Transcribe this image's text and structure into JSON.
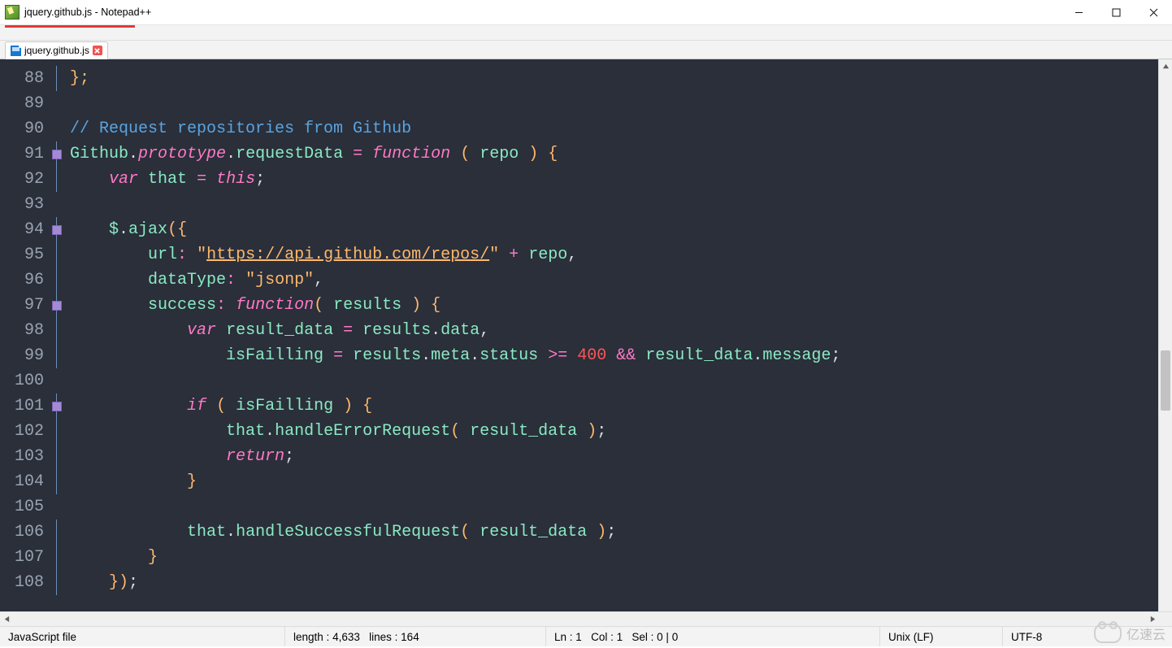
{
  "window": {
    "title": "jquery.github.js - Notepad++"
  },
  "tabs": [
    {
      "label": "jquery.github.js",
      "modified": false,
      "active": true
    }
  ],
  "editor": {
    "first_line_no": 88,
    "fold": [
      "line",
      "",
      "",
      "sq-line",
      "line",
      "",
      "sq-line",
      "line",
      "line",
      "sq-line",
      "line",
      "line",
      "",
      "sq-line",
      "line",
      "line",
      "line",
      "",
      "line",
      "line",
      "line"
    ],
    "code_lines": [
      {
        "t": [
          [
            "brace",
            "};"
          ]
        ]
      },
      {
        "t": []
      },
      {
        "t": [
          [
            "comment",
            "// Request repositories from Github"
          ]
        ]
      },
      {
        "t": [
          [
            "ident",
            "Github"
          ],
          [
            "punc",
            "."
          ],
          [
            "kw2",
            "prototype"
          ],
          [
            "punc",
            "."
          ],
          [
            "ident",
            "requestData"
          ],
          [
            "punc",
            " "
          ],
          [
            "op",
            "="
          ],
          [
            "punc",
            " "
          ],
          [
            "kw2",
            "function"
          ],
          [
            "punc",
            " "
          ],
          [
            "brace",
            "("
          ],
          [
            "punc",
            " "
          ],
          [
            "ident",
            "repo"
          ],
          [
            "punc",
            " "
          ],
          [
            "brace",
            ")"
          ],
          [
            "punc",
            " "
          ],
          [
            "brace",
            "{"
          ]
        ]
      },
      {
        "t": [
          [
            "punc",
            "    "
          ],
          [
            "kw2",
            "var"
          ],
          [
            "punc",
            " "
          ],
          [
            "ident",
            "that"
          ],
          [
            "punc",
            " "
          ],
          [
            "op",
            "="
          ],
          [
            "punc",
            " "
          ],
          [
            "kw2",
            "this"
          ],
          [
            "punc",
            ";"
          ]
        ]
      },
      {
        "t": []
      },
      {
        "t": [
          [
            "punc",
            "    "
          ],
          [
            "ident",
            "$"
          ],
          [
            "punc",
            "."
          ],
          [
            "ident",
            "ajax"
          ],
          [
            "brace",
            "("
          ],
          [
            "brace",
            "{"
          ]
        ]
      },
      {
        "t": [
          [
            "punc",
            "        "
          ],
          [
            "ident",
            "url"
          ],
          [
            "op",
            ":"
          ],
          [
            "punc",
            " "
          ],
          [
            "str",
            "\""
          ],
          [
            "url",
            "https://api.github.com/repos/"
          ],
          [
            "str",
            "\""
          ],
          [
            "punc",
            " "
          ],
          [
            "op",
            "+"
          ],
          [
            "punc",
            " "
          ],
          [
            "ident",
            "repo"
          ],
          [
            "punc",
            ","
          ]
        ]
      },
      {
        "t": [
          [
            "punc",
            "        "
          ],
          [
            "ident",
            "dataType"
          ],
          [
            "op",
            ":"
          ],
          [
            "punc",
            " "
          ],
          [
            "str",
            "\"jsonp\""
          ],
          [
            "punc",
            ","
          ]
        ]
      },
      {
        "t": [
          [
            "punc",
            "        "
          ],
          [
            "ident",
            "success"
          ],
          [
            "op",
            ":"
          ],
          [
            "punc",
            " "
          ],
          [
            "kw2",
            "function"
          ],
          [
            "brace",
            "("
          ],
          [
            "punc",
            " "
          ],
          [
            "ident",
            "results"
          ],
          [
            "punc",
            " "
          ],
          [
            "brace",
            ")"
          ],
          [
            "punc",
            " "
          ],
          [
            "brace",
            "{"
          ]
        ]
      },
      {
        "t": [
          [
            "punc",
            "            "
          ],
          [
            "kw2",
            "var"
          ],
          [
            "punc",
            " "
          ],
          [
            "ident",
            "result_data"
          ],
          [
            "punc",
            " "
          ],
          [
            "op",
            "="
          ],
          [
            "punc",
            " "
          ],
          [
            "ident",
            "results"
          ],
          [
            "punc",
            "."
          ],
          [
            "ident",
            "data"
          ],
          [
            "punc",
            ","
          ]
        ]
      },
      {
        "t": [
          [
            "punc",
            "                "
          ],
          [
            "ident",
            "isFailling"
          ],
          [
            "punc",
            " "
          ],
          [
            "op",
            "="
          ],
          [
            "punc",
            " "
          ],
          [
            "ident",
            "results"
          ],
          [
            "punc",
            "."
          ],
          [
            "ident",
            "meta"
          ],
          [
            "punc",
            "."
          ],
          [
            "ident",
            "status"
          ],
          [
            "punc",
            " "
          ],
          [
            "op",
            ">="
          ],
          [
            "punc",
            " "
          ],
          [
            "num",
            "400"
          ],
          [
            "punc",
            " "
          ],
          [
            "op",
            "&&"
          ],
          [
            "punc",
            " "
          ],
          [
            "ident",
            "result_data"
          ],
          [
            "punc",
            "."
          ],
          [
            "ident",
            "message"
          ],
          [
            "punc",
            ";"
          ]
        ]
      },
      {
        "t": []
      },
      {
        "t": [
          [
            "punc",
            "            "
          ],
          [
            "kw2",
            "if"
          ],
          [
            "punc",
            " "
          ],
          [
            "brace",
            "("
          ],
          [
            "punc",
            " "
          ],
          [
            "ident",
            "isFailling"
          ],
          [
            "punc",
            " "
          ],
          [
            "brace",
            ")"
          ],
          [
            "punc",
            " "
          ],
          [
            "brace",
            "{"
          ]
        ]
      },
      {
        "t": [
          [
            "punc",
            "                "
          ],
          [
            "ident",
            "that"
          ],
          [
            "punc",
            "."
          ],
          [
            "ident",
            "handleErrorRequest"
          ],
          [
            "brace",
            "("
          ],
          [
            "punc",
            " "
          ],
          [
            "ident",
            "result_data"
          ],
          [
            "punc",
            " "
          ],
          [
            "brace",
            ")"
          ],
          [
            "punc",
            ";"
          ]
        ]
      },
      {
        "t": [
          [
            "punc",
            "                "
          ],
          [
            "kw2",
            "return"
          ],
          [
            "punc",
            ";"
          ]
        ]
      },
      {
        "t": [
          [
            "punc",
            "            "
          ],
          [
            "brace",
            "}"
          ]
        ]
      },
      {
        "t": []
      },
      {
        "t": [
          [
            "punc",
            "            "
          ],
          [
            "ident",
            "that"
          ],
          [
            "punc",
            "."
          ],
          [
            "ident",
            "handleSuccessfulRequest"
          ],
          [
            "brace",
            "("
          ],
          [
            "punc",
            " "
          ],
          [
            "ident",
            "result_data"
          ],
          [
            "punc",
            " "
          ],
          [
            "brace",
            ")"
          ],
          [
            "punc",
            ";"
          ]
        ]
      },
      {
        "t": [
          [
            "punc",
            "        "
          ],
          [
            "brace",
            "}"
          ]
        ]
      },
      {
        "t": [
          [
            "punc",
            "    "
          ],
          [
            "brace",
            "})"
          ],
          [
            "punc",
            ";"
          ]
        ]
      }
    ]
  },
  "scroll": {
    "vthumb_top_pct": 51,
    "vthumb_height_pct": 11
  },
  "status": {
    "filetype": "JavaScript file",
    "length_label": "length :",
    "length_value": "4,633",
    "lines_label": "lines :",
    "lines_value": "164",
    "ln_label": "Ln :",
    "ln": "1",
    "col_label": "Col :",
    "col": "1",
    "sel_label": "Sel :",
    "sel": "0 | 0",
    "eol": "Unix (LF)",
    "encoding": "UTF-8"
  },
  "watermark": "亿速云"
}
